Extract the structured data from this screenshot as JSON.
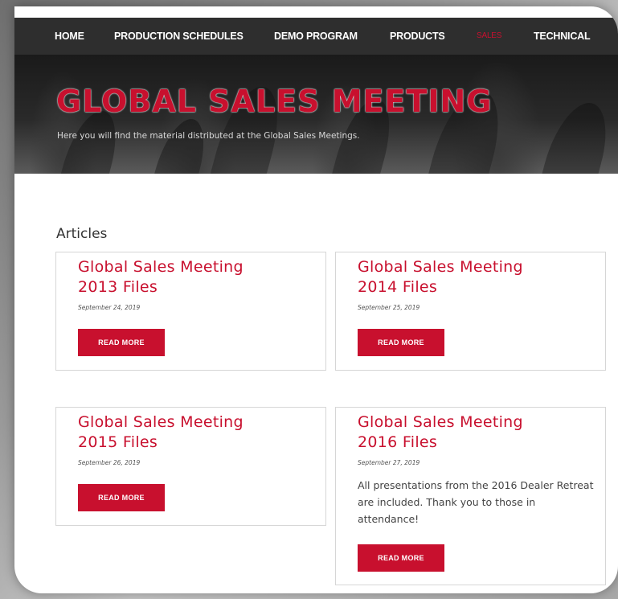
{
  "nav": {
    "items": [
      {
        "label": "HOME",
        "active": false
      },
      {
        "label": "PRODUCTION SCHEDULES",
        "active": false
      },
      {
        "label": "DEMO PROGRAM",
        "active": false
      },
      {
        "label": "PRODUCTS",
        "active": false
      },
      {
        "label": "SALES",
        "active": true
      },
      {
        "label": "TECHNICAL",
        "active": false
      }
    ]
  },
  "hero": {
    "title": "GLOBAL SALES MEETING",
    "subtitle": "Here you will find the material distributed at the Global Sales Meetings."
  },
  "section": {
    "title": "Articles"
  },
  "articles": [
    {
      "title_line1": "Global Sales Meeting",
      "title_line2": "2013 Files",
      "date": "September 24, 2019",
      "excerpt": "",
      "button": "READ MORE"
    },
    {
      "title_line1": "Global Sales Meeting",
      "title_line2": "2014 Files",
      "date": "September 25, 2019",
      "excerpt": "",
      "button": "READ MORE"
    },
    {
      "title_line1": "Global Sales Meeting",
      "title_line2": "2015 Files",
      "date": "September 26, 2019",
      "excerpt": "",
      "button": "READ MORE"
    },
    {
      "title_line1": "Global Sales Meeting",
      "title_line2": "2016 Files",
      "date": "September 27, 2019",
      "excerpt": "All presentations from the 2016 Dealer Retreat are included. Thank you to those in attendance!",
      "button": "READ MORE"
    }
  ],
  "colors": {
    "accent": "#c8102e",
    "nav_bg": "#2e2e2e",
    "hero_bg": "#1f1f1f"
  }
}
